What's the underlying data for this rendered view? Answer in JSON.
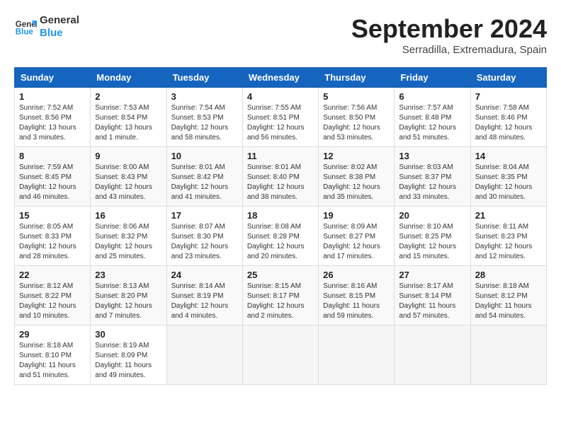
{
  "header": {
    "logo_line1": "General",
    "logo_line2": "Blue",
    "month_year": "September 2024",
    "location": "Serradilla, Extremadura, Spain"
  },
  "weekdays": [
    "Sunday",
    "Monday",
    "Tuesday",
    "Wednesday",
    "Thursday",
    "Friday",
    "Saturday"
  ],
  "weeks": [
    [
      {
        "day": "1",
        "info": "Sunrise: 7:52 AM\nSunset: 8:56 PM\nDaylight: 13 hours\nand 3 minutes."
      },
      {
        "day": "2",
        "info": "Sunrise: 7:53 AM\nSunset: 8:54 PM\nDaylight: 13 hours\nand 1 minute."
      },
      {
        "day": "3",
        "info": "Sunrise: 7:54 AM\nSunset: 8:53 PM\nDaylight: 12 hours\nand 58 minutes."
      },
      {
        "day": "4",
        "info": "Sunrise: 7:55 AM\nSunset: 8:51 PM\nDaylight: 12 hours\nand 56 minutes."
      },
      {
        "day": "5",
        "info": "Sunrise: 7:56 AM\nSunset: 8:50 PM\nDaylight: 12 hours\nand 53 minutes."
      },
      {
        "day": "6",
        "info": "Sunrise: 7:57 AM\nSunset: 8:48 PM\nDaylight: 12 hours\nand 51 minutes."
      },
      {
        "day": "7",
        "info": "Sunrise: 7:58 AM\nSunset: 8:46 PM\nDaylight: 12 hours\nand 48 minutes."
      }
    ],
    [
      {
        "day": "8",
        "info": "Sunrise: 7:59 AM\nSunset: 8:45 PM\nDaylight: 12 hours\nand 46 minutes."
      },
      {
        "day": "9",
        "info": "Sunrise: 8:00 AM\nSunset: 8:43 PM\nDaylight: 12 hours\nand 43 minutes."
      },
      {
        "day": "10",
        "info": "Sunrise: 8:01 AM\nSunset: 8:42 PM\nDaylight: 12 hours\nand 41 minutes."
      },
      {
        "day": "11",
        "info": "Sunrise: 8:01 AM\nSunset: 8:40 PM\nDaylight: 12 hours\nand 38 minutes."
      },
      {
        "day": "12",
        "info": "Sunrise: 8:02 AM\nSunset: 8:38 PM\nDaylight: 12 hours\nand 35 minutes."
      },
      {
        "day": "13",
        "info": "Sunrise: 8:03 AM\nSunset: 8:37 PM\nDaylight: 12 hours\nand 33 minutes."
      },
      {
        "day": "14",
        "info": "Sunrise: 8:04 AM\nSunset: 8:35 PM\nDaylight: 12 hours\nand 30 minutes."
      }
    ],
    [
      {
        "day": "15",
        "info": "Sunrise: 8:05 AM\nSunset: 8:33 PM\nDaylight: 12 hours\nand 28 minutes."
      },
      {
        "day": "16",
        "info": "Sunrise: 8:06 AM\nSunset: 8:32 PM\nDaylight: 12 hours\nand 25 minutes."
      },
      {
        "day": "17",
        "info": "Sunrise: 8:07 AM\nSunset: 8:30 PM\nDaylight: 12 hours\nand 23 minutes."
      },
      {
        "day": "18",
        "info": "Sunrise: 8:08 AM\nSunset: 8:28 PM\nDaylight: 12 hours\nand 20 minutes."
      },
      {
        "day": "19",
        "info": "Sunrise: 8:09 AM\nSunset: 8:27 PM\nDaylight: 12 hours\nand 17 minutes."
      },
      {
        "day": "20",
        "info": "Sunrise: 8:10 AM\nSunset: 8:25 PM\nDaylight: 12 hours\nand 15 minutes."
      },
      {
        "day": "21",
        "info": "Sunrise: 8:11 AM\nSunset: 8:23 PM\nDaylight: 12 hours\nand 12 minutes."
      }
    ],
    [
      {
        "day": "22",
        "info": "Sunrise: 8:12 AM\nSunset: 8:22 PM\nDaylight: 12 hours\nand 10 minutes."
      },
      {
        "day": "23",
        "info": "Sunrise: 8:13 AM\nSunset: 8:20 PM\nDaylight: 12 hours\nand 7 minutes."
      },
      {
        "day": "24",
        "info": "Sunrise: 8:14 AM\nSunset: 8:19 PM\nDaylight: 12 hours\nand 4 minutes."
      },
      {
        "day": "25",
        "info": "Sunrise: 8:15 AM\nSunset: 8:17 PM\nDaylight: 12 hours\nand 2 minutes."
      },
      {
        "day": "26",
        "info": "Sunrise: 8:16 AM\nSunset: 8:15 PM\nDaylight: 11 hours\nand 59 minutes."
      },
      {
        "day": "27",
        "info": "Sunrise: 8:17 AM\nSunset: 8:14 PM\nDaylight: 11 hours\nand 57 minutes."
      },
      {
        "day": "28",
        "info": "Sunrise: 8:18 AM\nSunset: 8:12 PM\nDaylight: 11 hours\nand 54 minutes."
      }
    ],
    [
      {
        "day": "29",
        "info": "Sunrise: 8:18 AM\nSunset: 8:10 PM\nDaylight: 11 hours\nand 51 minutes."
      },
      {
        "day": "30",
        "info": "Sunrise: 8:19 AM\nSunset: 8:09 PM\nDaylight: 11 hours\nand 49 minutes."
      },
      {
        "day": "",
        "info": ""
      },
      {
        "day": "",
        "info": ""
      },
      {
        "day": "",
        "info": ""
      },
      {
        "day": "",
        "info": ""
      },
      {
        "day": "",
        "info": ""
      }
    ]
  ]
}
